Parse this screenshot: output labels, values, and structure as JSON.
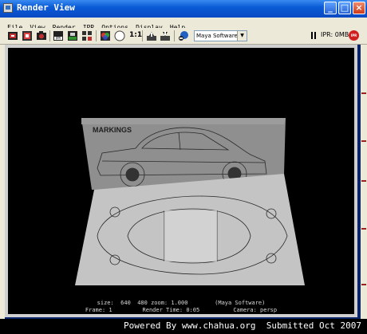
{
  "window": {
    "title": "Render View",
    "controls": {
      "minimize": "_",
      "maximize": "□",
      "close": "×"
    }
  },
  "menu": [
    "File",
    "View",
    "Render",
    "IPR",
    "Options",
    "Display",
    "Help"
  ],
  "toolbar": {
    "ratio_label": "1:1",
    "renderer": "Maya Software",
    "ipr_status": "IPR: 0MB",
    "ipr_badge": "IPR",
    "icons": [
      "redo-previous-render-icon",
      "render-region-icon",
      "snapshot-icon",
      "ipr-render-icon",
      "refresh-ipr-icon",
      "keep-image-icon",
      "rgb-channels-icon",
      "alpha-channel-icon",
      "real-size-icon",
      "keep-image-in-album-icon",
      "remove-image-icon",
      "render-globals-icon",
      "renderer-select-icon",
      "pause-ipr-icon"
    ]
  },
  "render": {
    "scene_label": "MARKINGS",
    "status_line_1": "size:  640  480 zoom: 1.000        (Maya Software)",
    "status_line_2": "Frame: 1         Render Time: 0:05          Camera: persp"
  },
  "watermark": "Powered By www.chahua.org  Submitted Oct 2007",
  "colors": {
    "title_bar": "#0b5bd6",
    "chrome": "#ece9d8",
    "canvas": "#000000",
    "plane": "#8c8c8c"
  }
}
